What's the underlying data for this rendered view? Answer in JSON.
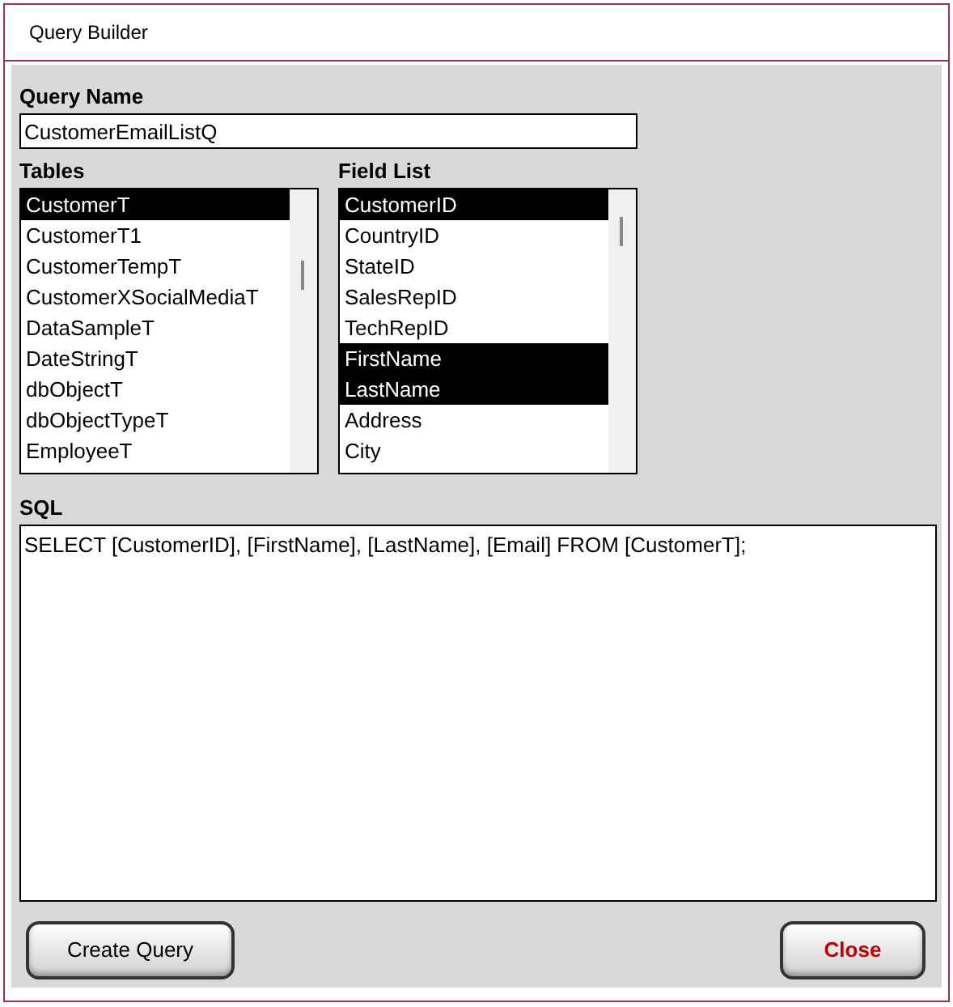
{
  "window": {
    "title": "Query Builder"
  },
  "query_name": {
    "label": "Query Name",
    "value": "CustomerEmailListQ"
  },
  "tables": {
    "label": "Tables",
    "items": [
      {
        "label": "CustomerT",
        "selected": true
      },
      {
        "label": "CustomerT1",
        "selected": false
      },
      {
        "label": "CustomerTempT",
        "selected": false
      },
      {
        "label": "CustomerXSocialMediaT",
        "selected": false
      },
      {
        "label": "DataSampleT",
        "selected": false
      },
      {
        "label": "DateStringT",
        "selected": false
      },
      {
        "label": "dbObjectT",
        "selected": false
      },
      {
        "label": "dbObjectTypeT",
        "selected": false
      },
      {
        "label": "EmployeeT",
        "selected": false
      }
    ]
  },
  "field_list": {
    "label": "Field List",
    "items": [
      {
        "label": "CustomerID",
        "selected": true
      },
      {
        "label": "CountryID",
        "selected": false
      },
      {
        "label": "StateID",
        "selected": false
      },
      {
        "label": "SalesRepID",
        "selected": false
      },
      {
        "label": "TechRepID",
        "selected": false
      },
      {
        "label": "FirstName",
        "selected": true
      },
      {
        "label": "LastName",
        "selected": true
      },
      {
        "label": "Address",
        "selected": false
      },
      {
        "label": "City",
        "selected": false
      }
    ]
  },
  "sql": {
    "label": "SQL",
    "value": "SELECT [CustomerID], [FirstName], [LastName], [Email] FROM [CustomerT];"
  },
  "buttons": [
    {
      "label": "Create Query",
      "kind": "default"
    },
    {
      "label": "Close",
      "kind": "danger"
    }
  ]
}
